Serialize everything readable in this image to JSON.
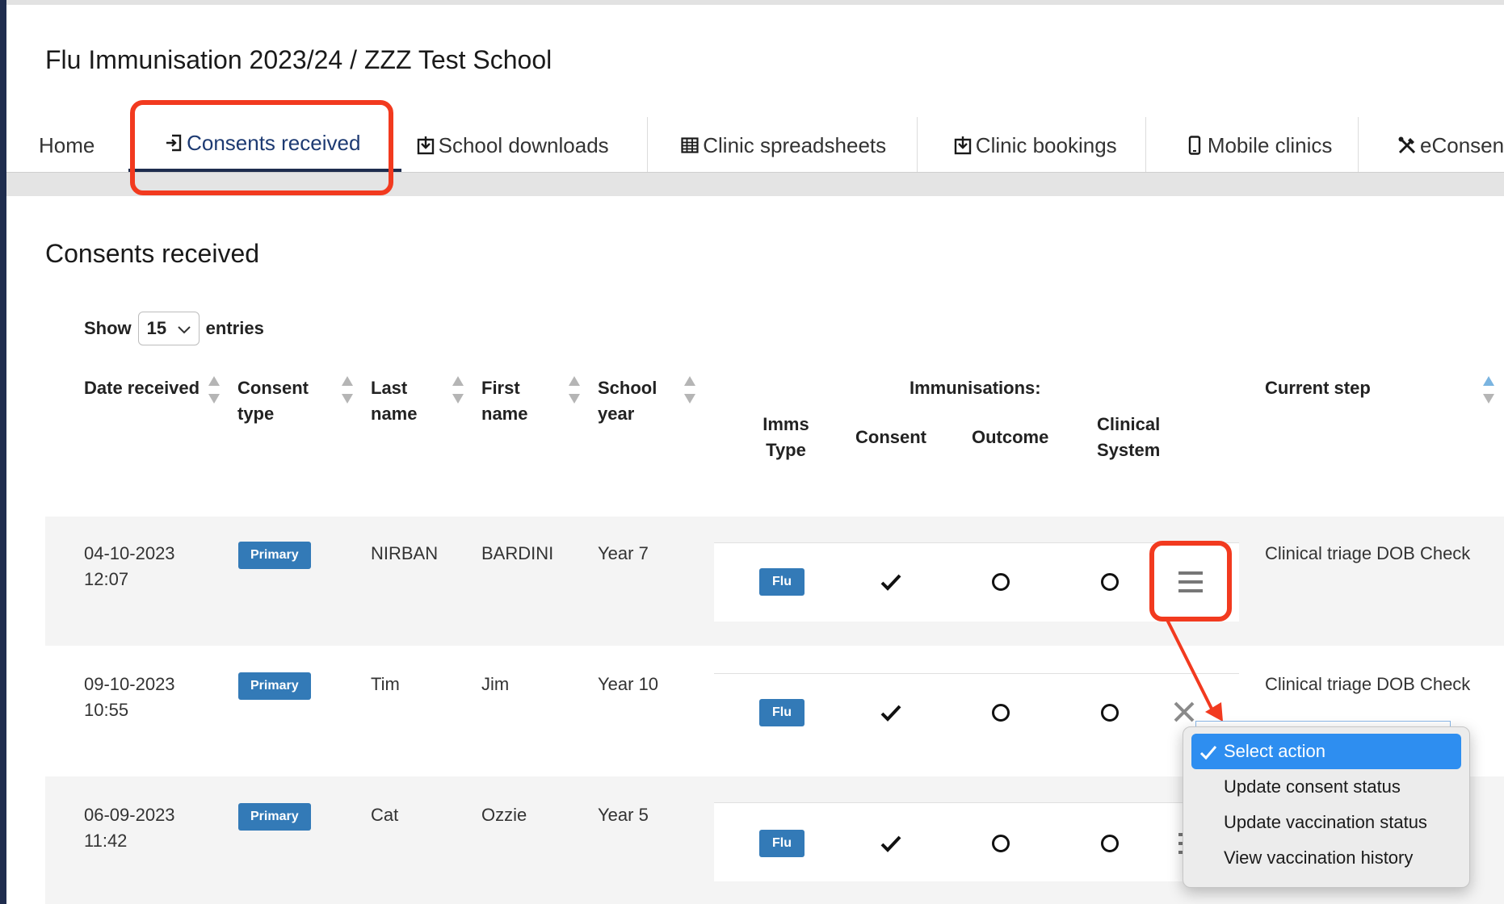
{
  "page": {
    "title": "Flu Immunisation 2023/24 / ZZZ Test School"
  },
  "tabs": [
    {
      "label": "Home",
      "icon": "none"
    },
    {
      "label": "Consents received",
      "icon": "sign-in-icon"
    },
    {
      "label": "School downloads",
      "icon": "download-icon"
    },
    {
      "label": "Clinic spreadsheets",
      "icon": "table-icon"
    },
    {
      "label": "Clinic bookings",
      "icon": "download-icon"
    },
    {
      "label": "Mobile clinics",
      "icon": "mobile-icon"
    },
    {
      "label": "eConsen",
      "icon": "tools-icon"
    }
  ],
  "section": {
    "title": "Consents received"
  },
  "length_menu": {
    "show_label": "Show",
    "value": "15",
    "entries_label": "entries"
  },
  "table": {
    "headers": {
      "date_received": "Date received",
      "consent_type_1": "Consent",
      "consent_type_2": "type",
      "last_name_1": "Last",
      "last_name_2": "name",
      "first_name_1": "First",
      "first_name_2": "name",
      "school_year_1": "School",
      "school_year_2": "year",
      "immunisations": "Immunisations:",
      "imms_type_1": "Imms",
      "imms_type_2": "Type",
      "consent": "Consent",
      "outcome": "Outcome",
      "clinical_system_1": "Clinical",
      "clinical_system_2": "System",
      "current_step": "Current step"
    },
    "rows": [
      {
        "date": "04-10-2023",
        "time": "12:07",
        "consent_type": "Primary",
        "last_name": "NIRBAN",
        "first_name": "BARDINI",
        "school_year": "Year 7",
        "imms_type": "Flu",
        "current_step": "Clinical triage DOB Check"
      },
      {
        "date": "09-10-2023",
        "time": "10:55",
        "consent_type": "Primary",
        "last_name": "Tim",
        "first_name": "Jim",
        "school_year": "Year 10",
        "imms_type": "Flu",
        "current_step": "Clinical triage DOB Check"
      },
      {
        "date": "06-09-2023",
        "time": "11:42",
        "consent_type": "Primary",
        "last_name": "Cat",
        "first_name": "Ozzie",
        "school_year": "Year 5",
        "imms_type": "Flu",
        "current_step": ""
      }
    ]
  },
  "action_menu": {
    "options": [
      "Select action",
      "Update consent status",
      "Update vaccination status",
      "View vaccination history"
    ],
    "selected": "Select action"
  },
  "colors": {
    "highlight": "#f23a1f",
    "badge": "#337ab7",
    "selected_option": "#2e8ef0",
    "nav_active": "#1f2d4e"
  }
}
